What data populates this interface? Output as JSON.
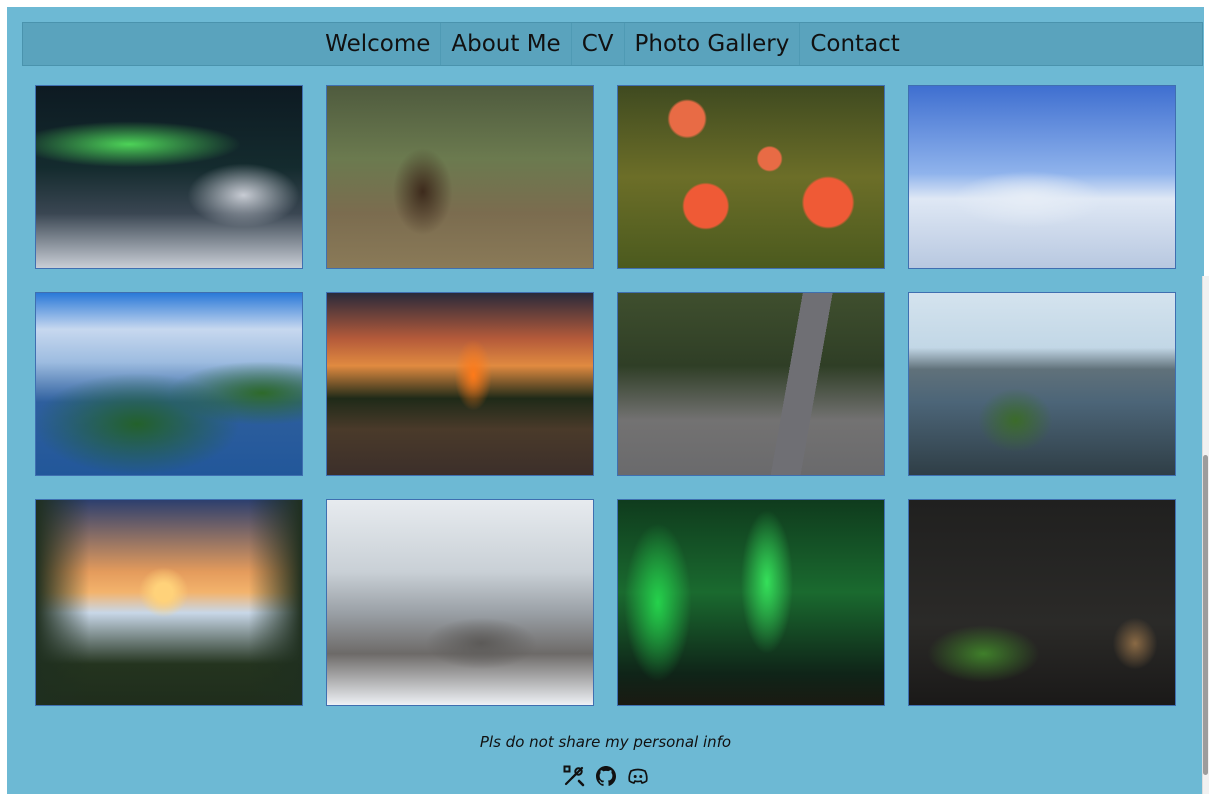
{
  "nav": {
    "items": [
      {
        "label": "Welcome"
      },
      {
        "label": "About Me"
      },
      {
        "label": "CV"
      },
      {
        "label": "Photo Gallery"
      },
      {
        "label": "Contact"
      }
    ]
  },
  "gallery": {
    "photos": [
      {
        "name": "aurora-forest-photo"
      },
      {
        "name": "bear-photo"
      },
      {
        "name": "cloudberries-photo"
      },
      {
        "name": "snowy-trees-photo"
      },
      {
        "name": "lake-aerial-photo"
      },
      {
        "name": "bonfire-photo"
      },
      {
        "name": "reindeer-road-photo"
      },
      {
        "name": "misty-lake-photo"
      },
      {
        "name": "sunset-pines-photo"
      },
      {
        "name": "winter-river-photo"
      },
      {
        "name": "aurora-sky-photo"
      },
      {
        "name": "sauna-photo"
      }
    ]
  },
  "footer": {
    "text": "Pls do not share my personal info",
    "icons": [
      "tools-icon",
      "github-icon",
      "discord-icon"
    ]
  },
  "colors": {
    "page_bg": "#6db9d4",
    "nav_bg": "#5aa3bd",
    "photo_border": "#3f6fb0"
  }
}
